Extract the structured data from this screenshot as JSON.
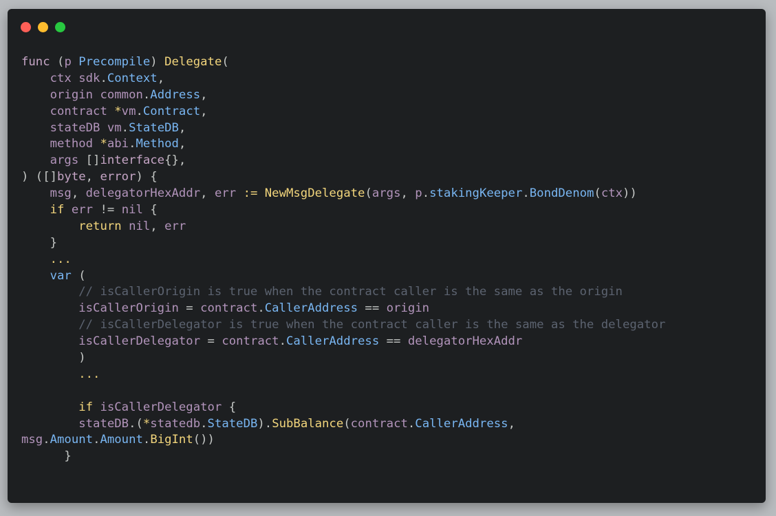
{
  "window": {
    "background": "#1d1f21",
    "controls": [
      {
        "name": "close-dot",
        "color": "#fe5f57"
      },
      {
        "name": "minimize-dot",
        "color": "#febc2e"
      },
      {
        "name": "zoom-dot",
        "color": "#28c840"
      }
    ]
  },
  "colors": {
    "kw": "#c5a5c5",
    "ident": "#b294bb",
    "type": "#79b6f2",
    "func": "#f2d57c",
    "plain": "#c5c8c6",
    "comment": "#5c6370",
    "op": "#81a2be"
  },
  "code": {
    "lines": [
      [
        [
          "func ",
          "kw"
        ],
        [
          "(",
          "plain"
        ],
        [
          "p ",
          "ident"
        ],
        [
          "Precompile",
          "type"
        ],
        [
          ") ",
          "plain"
        ],
        [
          "Delegate",
          "func"
        ],
        [
          "(",
          "plain"
        ]
      ],
      [
        [
          "    ctx ",
          "ident"
        ],
        [
          "sdk",
          "ident"
        ],
        [
          ".",
          "plain"
        ],
        [
          "Context",
          "type"
        ],
        [
          ",",
          "plain"
        ]
      ],
      [
        [
          "    origin ",
          "ident"
        ],
        [
          "common",
          "ident"
        ],
        [
          ".",
          "plain"
        ],
        [
          "Address",
          "type"
        ],
        [
          ",",
          "plain"
        ]
      ],
      [
        [
          "    contract ",
          "ident"
        ],
        [
          "*",
          "func"
        ],
        [
          "vm",
          "ident"
        ],
        [
          ".",
          "plain"
        ],
        [
          "Contract",
          "type"
        ],
        [
          ",",
          "plain"
        ]
      ],
      [
        [
          "    stateDB ",
          "ident"
        ],
        [
          "vm",
          "ident"
        ],
        [
          ".",
          "plain"
        ],
        [
          "StateDB",
          "type"
        ],
        [
          ",",
          "plain"
        ]
      ],
      [
        [
          "    method ",
          "ident"
        ],
        [
          "*",
          "func"
        ],
        [
          "abi",
          "ident"
        ],
        [
          ".",
          "plain"
        ],
        [
          "Method",
          "type"
        ],
        [
          ",",
          "plain"
        ]
      ],
      [
        [
          "    args ",
          "ident"
        ],
        [
          "[]",
          "plain"
        ],
        [
          "interface",
          "kw"
        ],
        [
          "{},",
          "plain"
        ]
      ],
      [
        [
          ") ([]",
          "plain"
        ],
        [
          "byte",
          "kw"
        ],
        [
          ", ",
          "plain"
        ],
        [
          "error",
          "kw"
        ],
        [
          ") {",
          "plain"
        ]
      ],
      [
        [
          "    msg",
          "ident"
        ],
        [
          ", ",
          "plain"
        ],
        [
          "delegatorHexAddr",
          "ident"
        ],
        [
          ", ",
          "plain"
        ],
        [
          "err ",
          "ident"
        ],
        [
          ":= ",
          "func"
        ],
        [
          "NewMsgDelegate",
          "func"
        ],
        [
          "(",
          "plain"
        ],
        [
          "args",
          "ident"
        ],
        [
          ", ",
          "plain"
        ],
        [
          "p",
          "ident"
        ],
        [
          ".",
          "plain"
        ],
        [
          "stakingKeeper",
          "type"
        ],
        [
          ".",
          "plain"
        ],
        [
          "BondDenom",
          "type"
        ],
        [
          "(",
          "plain"
        ],
        [
          "ctx",
          "ident"
        ],
        [
          "))",
          "plain"
        ]
      ],
      [
        [
          "    if ",
          "func"
        ],
        [
          "err ",
          "ident"
        ],
        [
          "!= ",
          "plain"
        ],
        [
          "nil",
          "ident"
        ],
        [
          " {",
          "plain"
        ]
      ],
      [
        [
          "        return ",
          "func"
        ],
        [
          "nil",
          "ident"
        ],
        [
          ", ",
          "plain"
        ],
        [
          "err",
          "ident"
        ]
      ],
      [
        [
          "    }",
          "plain"
        ]
      ],
      [
        [
          "    ...",
          "func"
        ]
      ],
      [
        [
          "    var ",
          "type"
        ],
        [
          "(",
          "plain"
        ]
      ],
      [
        [
          "        // isCallerOrigin is true when the contract caller is the same as the origin",
          "comment"
        ]
      ],
      [
        [
          "        isCallerOrigin ",
          "ident"
        ],
        [
          "= ",
          "plain"
        ],
        [
          "contract",
          "ident"
        ],
        [
          ".",
          "plain"
        ],
        [
          "CallerAddress ",
          "type"
        ],
        [
          "== ",
          "plain"
        ],
        [
          "origin",
          "ident"
        ]
      ],
      [
        [
          "        // isCallerDelegator is true when the contract caller is the same as the delegator",
          "comment"
        ]
      ],
      [
        [
          "        isCallerDelegator ",
          "ident"
        ],
        [
          "= ",
          "plain"
        ],
        [
          "contract",
          "ident"
        ],
        [
          ".",
          "plain"
        ],
        [
          "CallerAddress ",
          "type"
        ],
        [
          "== ",
          "plain"
        ],
        [
          "delegatorHexAddr",
          "ident"
        ]
      ],
      [
        [
          "        )",
          "plain"
        ]
      ],
      [
        [
          "        ...",
          "func"
        ]
      ],
      [
        [
          "",
          "plain"
        ]
      ],
      [
        [
          "        if ",
          "func"
        ],
        [
          "isCallerDelegator",
          "ident"
        ],
        [
          " {",
          "plain"
        ]
      ],
      [
        [
          "        stateDB",
          "ident"
        ],
        [
          ".(",
          "plain"
        ],
        [
          "*",
          "func"
        ],
        [
          "statedb",
          "ident"
        ],
        [
          ".",
          "plain"
        ],
        [
          "StateDB",
          "type"
        ],
        [
          ").",
          "plain"
        ],
        [
          "SubBalance",
          "func"
        ],
        [
          "(",
          "plain"
        ],
        [
          "contract",
          "ident"
        ],
        [
          ".",
          "plain"
        ],
        [
          "CallerAddress",
          "type"
        ],
        [
          ",",
          "plain"
        ]
      ],
      [
        [
          "msg",
          "ident"
        ],
        [
          ".",
          "plain"
        ],
        [
          "Amount",
          "type"
        ],
        [
          ".",
          "plain"
        ],
        [
          "Amount",
          "type"
        ],
        [
          ".",
          "plain"
        ],
        [
          "BigInt",
          "func"
        ],
        [
          "())",
          "plain"
        ]
      ],
      [
        [
          "      }",
          "plain"
        ]
      ]
    ]
  }
}
